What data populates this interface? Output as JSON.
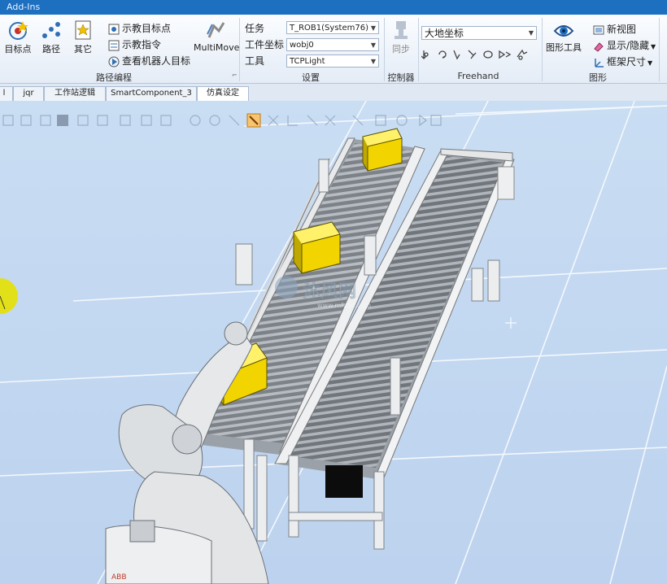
{
  "app": {
    "title": "Add-Ins"
  },
  "ribbon": {
    "path_group": {
      "label": "路径编程",
      "target_point": "目标点",
      "path": "路径",
      "other": "其它",
      "teach_target": "示教目标点",
      "teach_instruction": "示教指令",
      "view_robot_target": "查看机器人目标",
      "multimove": "MultiMove"
    },
    "settings_group": {
      "label": "设置",
      "task_label": "任务",
      "task_value": "T_ROB1(System76)",
      "workobj_label": "工件坐标",
      "workobj_value": "wobj0",
      "tool_label": "工具",
      "tool_value": "TCPLight"
    },
    "controller_group": {
      "label": "控制器",
      "sync": "同步"
    },
    "freehand_group": {
      "label": "Freehand",
      "frame_value": "大地坐标"
    },
    "graphics_group": {
      "label": "图形",
      "graphic_tools": "图形工具",
      "new_view": "新视图",
      "show_hide": "显示/隐藏",
      "frame_size": "框架尺寸"
    }
  },
  "tabs": [
    {
      "label": "l"
    },
    {
      "label": "jqr"
    },
    {
      "label": "工作站逻辑"
    },
    {
      "label": "SmartComponent_3"
    },
    {
      "label": "仿真设定"
    }
  ],
  "viewport": {
    "watermark_title": "沐风网",
    "watermark_url": "www.mfcad.com"
  },
  "colors": {
    "accent": "#1d6fc0",
    "box": "#f1d400",
    "floor": "#c5d9f2",
    "cursor_marker": "#e5e000"
  },
  "icons": [
    "target-point-icon",
    "path-icon",
    "other-icon",
    "teach-target-icon",
    "teach-instruction-icon",
    "view-robot-target-icon",
    "multimove-icon",
    "sync-icon",
    "graphic-tools-icon",
    "new-view-icon",
    "show-hide-icon",
    "frame-size-icon"
  ]
}
